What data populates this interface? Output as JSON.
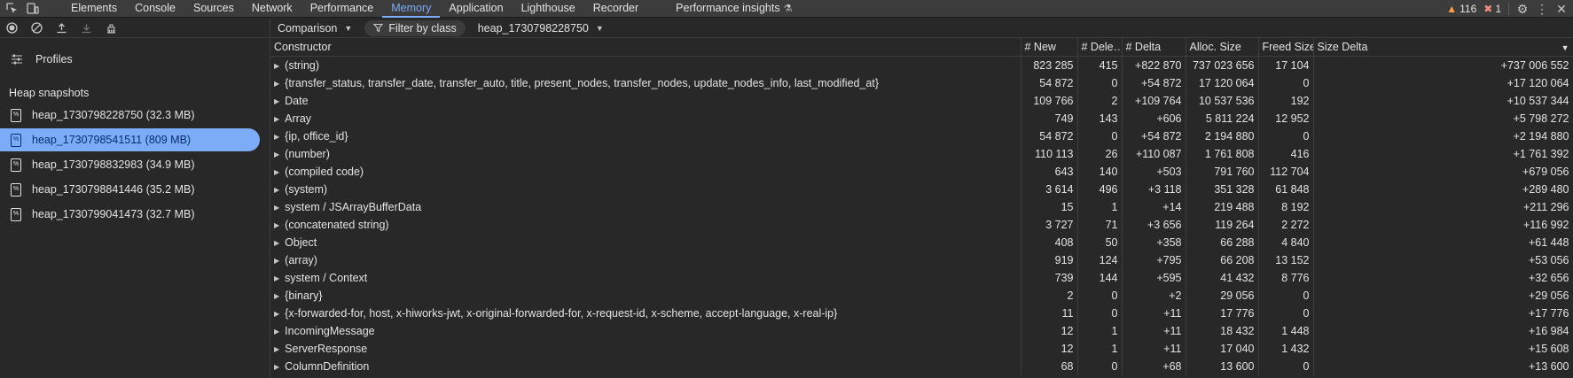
{
  "tabs": [
    "Elements",
    "Console",
    "Sources",
    "Network",
    "Performance",
    "Memory",
    "Application",
    "Lighthouse",
    "Recorder",
    "Performance insights"
  ],
  "active_tab": "Memory",
  "status": {
    "warnings": "116",
    "errors": "1"
  },
  "toolbar": {
    "view_mode": "Comparison",
    "filter_label": "Filter by class",
    "baseline_snapshot": "heap_1730798228750"
  },
  "sidebar": {
    "profiles_label": "Profiles",
    "section_title": "Heap snapshots",
    "snapshots": [
      "heap_1730798228750 (32.3 MB)",
      "heap_1730798541511 (809 MB)",
      "heap_1730798832983 (34.9 MB)",
      "heap_1730798841446 (35.2 MB)",
      "heap_1730799041473 (32.7 MB)"
    ],
    "selected_index": 1
  },
  "table": {
    "columns": [
      "Constructor",
      "# New",
      "# Dele…",
      "# Delta",
      "Alloc. Size",
      "Freed Size",
      "Size Delta"
    ],
    "rows": [
      [
        "(string)",
        "823 285",
        "415",
        "+822 870",
        "737 023 656",
        "17 104",
        "+737 006 552"
      ],
      [
        "{transfer_status, transfer_date, transfer_auto, title, present_nodes, transfer_nodes, update_nodes_info, last_modified_at}",
        "54 872",
        "0",
        "+54 872",
        "17 120 064",
        "0",
        "+17 120 064"
      ],
      [
        "Date",
        "109 766",
        "2",
        "+109 764",
        "10 537 536",
        "192",
        "+10 537 344"
      ],
      [
        "Array",
        "749",
        "143",
        "+606",
        "5 811 224",
        "12 952",
        "+5 798 272"
      ],
      [
        "{ip, office_id}",
        "54 872",
        "0",
        "+54 872",
        "2 194 880",
        "0",
        "+2 194 880"
      ],
      [
        "(number)",
        "110 113",
        "26",
        "+110 087",
        "1 761 808",
        "416",
        "+1 761 392"
      ],
      [
        "(compiled code)",
        "643",
        "140",
        "+503",
        "791 760",
        "112 704",
        "+679 056"
      ],
      [
        "(system)",
        "3 614",
        "496",
        "+3 118",
        "351 328",
        "61 848",
        "+289 480"
      ],
      [
        "system / JSArrayBufferData",
        "15",
        "1",
        "+14",
        "219 488",
        "8 192",
        "+211 296"
      ],
      [
        "(concatenated string)",
        "3 727",
        "71",
        "+3 656",
        "119 264",
        "2 272",
        "+116 992"
      ],
      [
        "Object",
        "408",
        "50",
        "+358",
        "66 288",
        "4 840",
        "+61 448"
      ],
      [
        "(array)",
        "919",
        "124",
        "+795",
        "66 208",
        "13 152",
        "+53 056"
      ],
      [
        "system / Context",
        "739",
        "144",
        "+595",
        "41 432",
        "8 776",
        "+32 656"
      ],
      [
        "{binary}",
        "2",
        "0",
        "+2",
        "29 056",
        "0",
        "+29 056"
      ],
      [
        "{x-forwarded-for, host, x-hiworks-jwt, x-original-forwarded-for, x-request-id, x-scheme, accept-language, x-real-ip}",
        "11",
        "0",
        "+11",
        "17 776",
        "0",
        "+17 776"
      ],
      [
        "IncomingMessage",
        "12",
        "1",
        "+11",
        "18 432",
        "1 448",
        "+16 984"
      ],
      [
        "ServerResponse",
        "12",
        "1",
        "+11",
        "17 040",
        "1 432",
        "+15 608"
      ],
      [
        "ColumnDefinition",
        "68",
        "0",
        "+68",
        "13 600",
        "0",
        "+13 600"
      ]
    ]
  }
}
